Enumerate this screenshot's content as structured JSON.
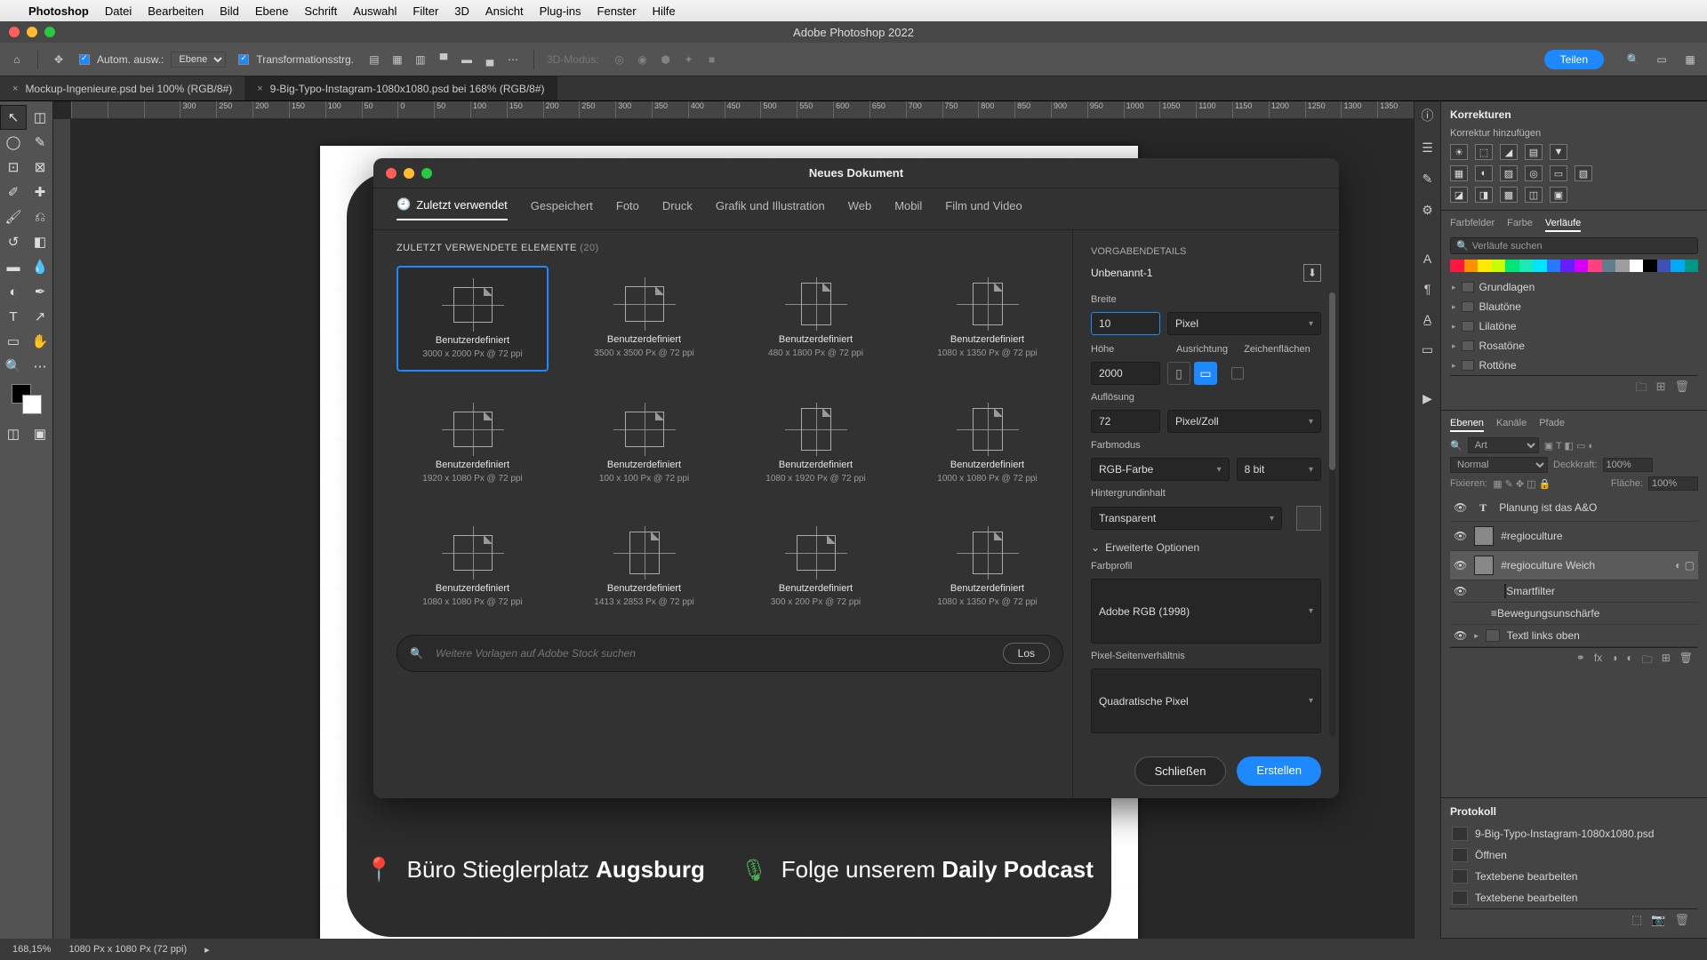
{
  "mac_menu": {
    "app": "Photoshop",
    "items": [
      "Datei",
      "Bearbeiten",
      "Bild",
      "Ebene",
      "Schrift",
      "Auswahl",
      "Filter",
      "3D",
      "Ansicht",
      "Plug-ins",
      "Fenster",
      "Hilfe"
    ]
  },
  "app_title": "Adobe Photoshop 2022",
  "options": {
    "auto_select": "Autom. ausw.:",
    "layer_sel": "Ebene",
    "transform": "Transformationsstrg.",
    "mode3d": "3D-Modus:",
    "share": "Teilen"
  },
  "tabs": [
    {
      "label": "Mockup-Ingenieure.psd bei 100% (RGB/8#)",
      "close": "×"
    },
    {
      "label": "9-Big-Typo-Instagram-1080x1080.psd bei 168% (RGB/8#)",
      "close": "×"
    }
  ],
  "ruler_ticks": [
    "",
    "",
    "",
    "300",
    "250",
    "200",
    "150",
    "100",
    "50",
    "0",
    "50",
    "100",
    "150",
    "200",
    "250",
    "300",
    "350",
    "400",
    "450",
    "500",
    "550",
    "600",
    "650",
    "700",
    "750",
    "800",
    "850",
    "900",
    "950",
    "1000",
    "1050",
    "1100",
    "1150",
    "1200",
    "1250",
    "1300",
    "1350"
  ],
  "canvas_footer": {
    "left_icon": "📍",
    "left_text_a": "Büro Stieglerplatz ",
    "left_text_b": "Augsburg",
    "right_icon": "🎙",
    "right_text_a": "Folge unserem ",
    "right_text_b": "Daily Podcast"
  },
  "adjust_panel": {
    "title": "Korrekturen",
    "hint": "Korrektur hinzufügen"
  },
  "swatch_panel": {
    "tabs": [
      "Farbfelder",
      "Farbe",
      "Verläufe"
    ],
    "active": 2,
    "search_ph": "Verläufe suchen",
    "grad_colors": [
      "#ff1744",
      "#ff9100",
      "#ffea00",
      "#c6ff00",
      "#00e676",
      "#1de9b6",
      "#00e5ff",
      "#2979ff",
      "#651fff",
      "#d500f9",
      "#ff4081",
      "#607d8b",
      "#9e9e9e",
      "#ffffff",
      "#000000",
      "#3f51b5",
      "#03a9f4",
      "#009688"
    ],
    "folders": [
      "Grundlagen",
      "Blautöne",
      "Lilatöne",
      "Rosatöne",
      "Rottöne"
    ]
  },
  "layers_panel": {
    "tabs": [
      "Ebenen",
      "Kanäle",
      "Pfade"
    ],
    "active": 0,
    "filter": "Art",
    "blend": "Normal",
    "opacity_lbl": "Deckkraft:",
    "opacity": "100%",
    "lock_lbl": "Fixieren:",
    "fill_lbl": "Fläche:",
    "fill": "100%",
    "layers": [
      {
        "eye": "👁",
        "type": "T",
        "name": "Planung ist das A&O"
      },
      {
        "eye": "👁",
        "type": "thumb",
        "name": "#regioculture"
      },
      {
        "eye": "👁",
        "type": "thumb",
        "name": "#regioculture Weich",
        "extra": true
      },
      {
        "eye": "👁",
        "type": "sf",
        "name": "Smartfilter",
        "indent": true
      },
      {
        "eye": "",
        "type": "fx",
        "name": "Bewegungsunschärfe",
        "indent": true
      },
      {
        "eye": "👁",
        "type": "group",
        "name": "Textl links oben",
        "arrow": "▸"
      }
    ]
  },
  "history_panel": {
    "title": "Protokoll",
    "doc": "9-Big-Typo-Instagram-1080x1080.psd",
    "items": [
      "Öffnen",
      "Textebene bearbeiten",
      "Textebene bearbeiten"
    ]
  },
  "status": {
    "zoom": "168,15%",
    "dims": "1080 Px x 1080 Px (72 ppi)",
    "arrow": "▸"
  },
  "dialog": {
    "title": "Neues Dokument",
    "tabs": [
      "Zuletzt verwendet",
      "Gespeichert",
      "Foto",
      "Druck",
      "Grafik und Illustration",
      "Web",
      "Mobil",
      "Film und Video"
    ],
    "active_tab": 0,
    "recent_head": "ZULETZT VERWENDETE ELEMENTE",
    "recent_count": "(20)",
    "presets": [
      {
        "n": "Benutzerdefiniert",
        "d": "3000 x 2000 Px @ 72 ppi",
        "sel": true,
        "o": "land"
      },
      {
        "n": "Benutzerdefiniert",
        "d": "3500 x 3500 Px @ 72 ppi",
        "o": "land"
      },
      {
        "n": "Benutzerdefiniert",
        "d": "480 x 1800 Px @ 72 ppi",
        "o": "port"
      },
      {
        "n": "Benutzerdefiniert",
        "d": "1080 x 1350 Px @ 72 ppi",
        "o": "port"
      },
      {
        "n": "Benutzerdefiniert",
        "d": "1920 x 1080 Px @ 72 ppi",
        "o": "land"
      },
      {
        "n": "Benutzerdefiniert",
        "d": "100 x 100 Px @ 72 ppi",
        "o": "land"
      },
      {
        "n": "Benutzerdefiniert",
        "d": "1080 x 1920 Px @ 72 ppi",
        "o": "port"
      },
      {
        "n": "Benutzerdefiniert",
        "d": "1000 x 1080 Px @ 72 ppi",
        "o": "port"
      },
      {
        "n": "Benutzerdefiniert",
        "d": "1080 x 1080 Px @ 72 ppi",
        "o": "land"
      },
      {
        "n": "Benutzerdefiniert",
        "d": "1413 x 2853 Px @ 72 ppi",
        "o": "port"
      },
      {
        "n": "Benutzerdefiniert",
        "d": "300 x 200 Px @ 72 ppi",
        "o": "land"
      },
      {
        "n": "Benutzerdefiniert",
        "d": "1080 x 1350 Px @ 72 ppi",
        "o": "port"
      }
    ],
    "search_ph": "Weitere Vorlagen auf Adobe Stock suchen",
    "search_go": "Los",
    "details_head": "VORGABENDETAILS",
    "name": "Unbenannt-1",
    "width_lbl": "Breite",
    "width": "10",
    "width_unit": "Pixel",
    "height_lbl": "Höhe",
    "height": "2000",
    "orient_lbl": "Ausrichtung",
    "artboard_lbl": "Zeichenflächen",
    "res_lbl": "Auflösung",
    "res": "72",
    "res_unit": "Pixel/Zoll",
    "mode_lbl": "Farbmodus",
    "mode": "RGB-Farbe",
    "depth": "8 bit",
    "bg_lbl": "Hintergrundinhalt",
    "bg": "Transparent",
    "adv_lbl": "Erweiterte Optionen",
    "profile_lbl": "Farbprofil",
    "profile": "Adobe RGB (1998)",
    "par_lbl": "Pixel-Seitenverhältnis",
    "par": "Quadratische Pixel",
    "close": "Schließen",
    "create": "Erstellen"
  }
}
